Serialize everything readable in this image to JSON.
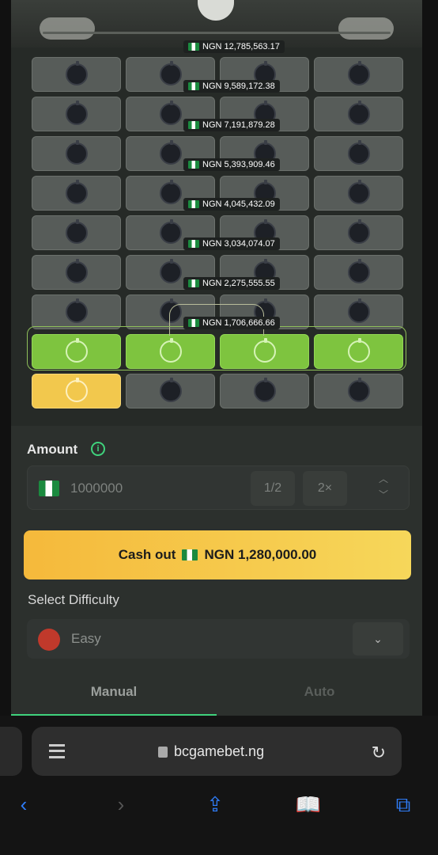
{
  "multipliers": [
    "NGN 12,785,563.17",
    "NGN 9,589,172.38",
    "NGN 7,191,879.28",
    "NGN 5,393,909.46",
    "NGN 4,045,432.09",
    "NGN 3,034,074.07",
    "NGN 2,275,555.55",
    "NGN 1,706,666.66"
  ],
  "panel": {
    "amount_label": "Amount",
    "amount_value": "1000000",
    "half": "1/2",
    "double": "2×",
    "cashout_prefix": "Cash out",
    "cashout_amount": "NGN 1,280,000.00",
    "difficulty_label": "Select Difficulty",
    "difficulty_value": "Easy",
    "tabs": [
      "Manual",
      "Auto"
    ]
  },
  "browser": {
    "url": "bcgamebet.ng"
  },
  "icons": {
    "info": "info-icon",
    "reader": "reader-icon",
    "lock": "lock-icon",
    "reload": "reload-icon",
    "back": "back-icon",
    "forward": "forward-icon",
    "share": "share-icon",
    "bookmarks": "bookmarks-icon",
    "tabs": "tabs-icon"
  },
  "colors": {
    "accent_green": "#3fd27c",
    "safe_tile": "#7ec43f",
    "picked_tile": "#f2c84d",
    "cashout_start": "#f5b93b",
    "cashout_end": "#f6d75a"
  }
}
